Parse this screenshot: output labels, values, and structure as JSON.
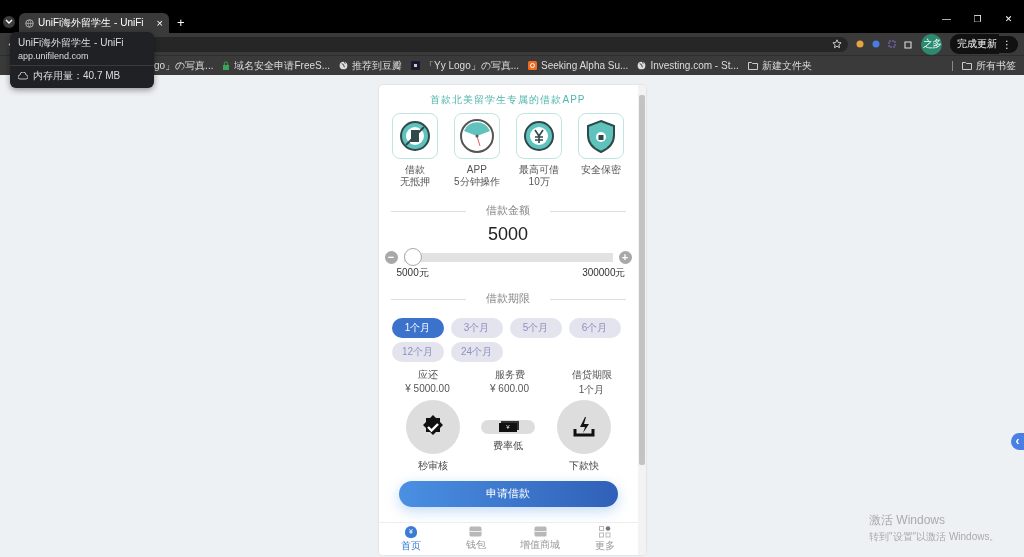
{
  "browser": {
    "tab": {
      "title": "UniFi海外留学生 - UniFi",
      "close": "×"
    },
    "new_tab": "+",
    "window_controls": [
      "—",
      "❐",
      "✕"
    ],
    "tooltip": {
      "title": "UniFi海外留学生 - UniFi",
      "url": "app.unifilend.com",
      "memory": "内存用量：40.7 MB"
    },
    "update_button": "完成更新",
    "update_menu": "⋮",
    "avatar": "之多",
    "bookmarks": [
      {
        "label": "go」の写真...",
        "kind": "none"
      },
      {
        "label": "域名安全申请FreeS...",
        "kind": "lock"
      },
      {
        "label": "推荐到豆瓣",
        "kind": "globe"
      },
      {
        "label": "「Yy Logo」の写真...",
        "kind": "square"
      },
      {
        "label": "Seeking Alpha Su...",
        "kind": "alpha"
      },
      {
        "label": "Investing.com - St...",
        "kind": "globe"
      },
      {
        "label": "新建文件夹",
        "kind": "folder"
      }
    ],
    "all_bookmarks": "所有书签"
  },
  "app": {
    "headline": "首款北美留学生专属的借款APP",
    "features": [
      {
        "kind": "pledge",
        "lines": [
          "借款",
          "无抵押"
        ]
      },
      {
        "kind": "clock",
        "lines": [
          "APP",
          "5分钟操作"
        ]
      },
      {
        "kind": "yen",
        "lines": [
          "最高可借",
          "10万"
        ]
      },
      {
        "kind": "shield",
        "lines": [
          "安全保密"
        ]
      }
    ],
    "amount_title": "借款金额",
    "amount": "5000",
    "slider": {
      "level": 0,
      "minus": "−",
      "plus": "+",
      "min": "5000元",
      "max": "300000元"
    },
    "term_title": "借款期限",
    "terms": [
      {
        "label": "1个月",
        "selected": true
      },
      {
        "label": "3个月",
        "selected": false
      },
      {
        "label": "5个月",
        "selected": false
      },
      {
        "label": "6个月",
        "selected": false
      },
      {
        "label": "12个月",
        "selected": false
      },
      {
        "label": "24个月",
        "selected": false
      }
    ],
    "summary": [
      {
        "label": "应还",
        "value": "¥ 5000.00"
      },
      {
        "label": "服务费",
        "value": "¥ 600.00"
      },
      {
        "label": "借贷期限",
        "value": "1个月"
      }
    ],
    "perks": [
      {
        "kind": "badge",
        "label": "秒审核"
      },
      {
        "kind": "money",
        "label": "费率低",
        "note": "¥"
      },
      {
        "kind": "bolt",
        "label": "下款快"
      }
    ],
    "apply_button": "申请借款",
    "nav": [
      {
        "label": "首页",
        "selected": true,
        "kind": "bag",
        "note": "¥"
      },
      {
        "label": "钱包",
        "selected": false,
        "kind": "wallet"
      },
      {
        "label": "增值商城",
        "selected": false,
        "kind": "wallet"
      },
      {
        "label": "更多",
        "selected": false,
        "kind": "grid"
      }
    ]
  },
  "side_handle": "‹",
  "windows_notice": {
    "title": "激活 Windows",
    "text": "转到\"设置\"以激活 Windows。"
  }
}
